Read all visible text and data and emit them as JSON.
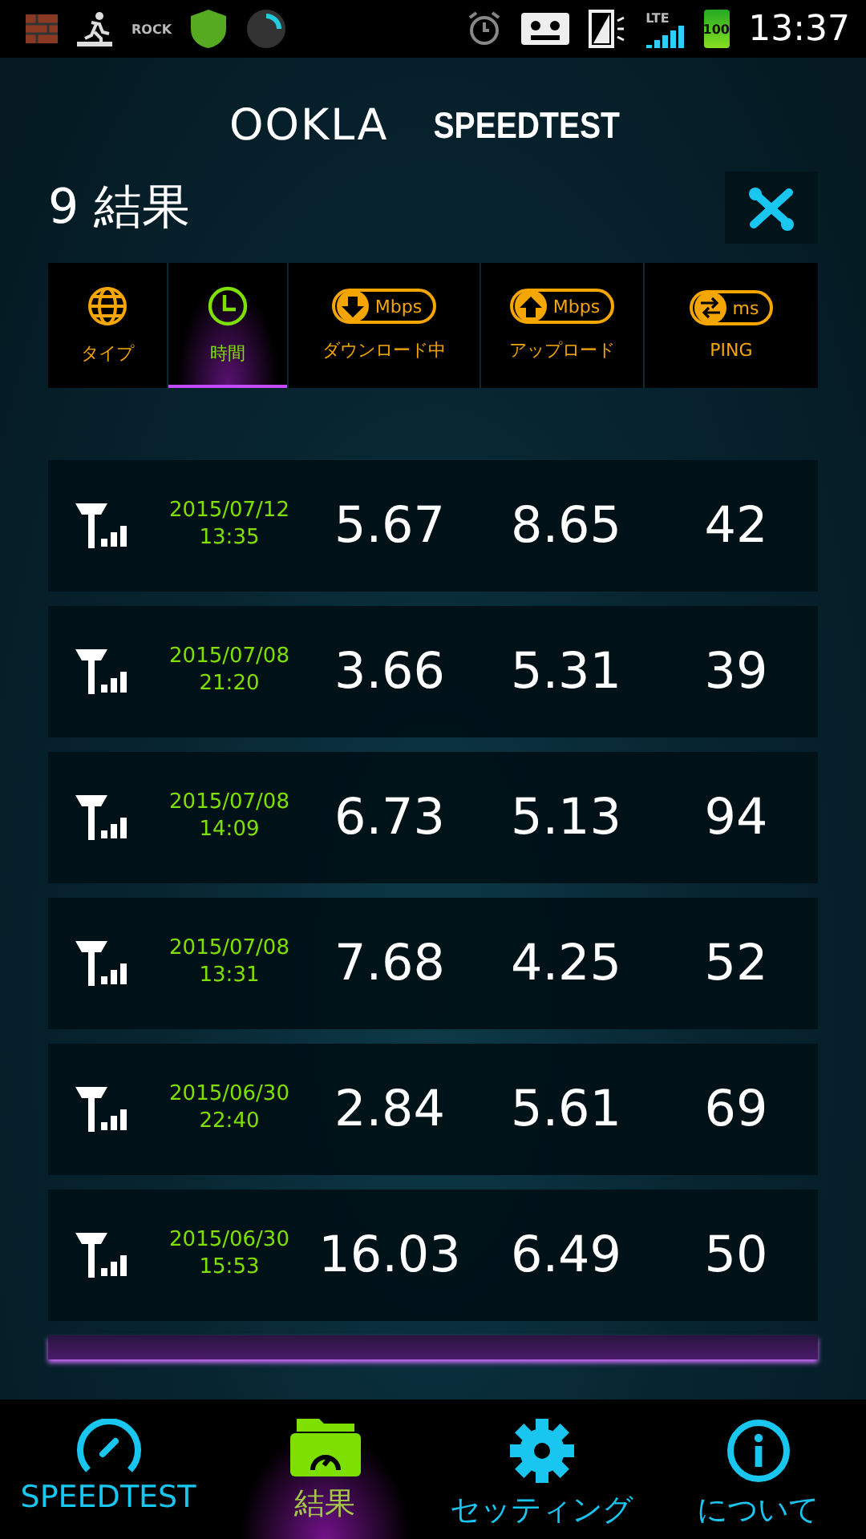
{
  "status_bar": {
    "app_label": "ROCK",
    "network_label": "LTE",
    "battery_label": "100",
    "time": "13:37"
  },
  "header": {
    "brand": "OOKLA",
    "product": "SPEEDTEST",
    "title": "9 結果"
  },
  "sort_columns": [
    {
      "kind": "type",
      "label": "タイプ",
      "selected": false
    },
    {
      "kind": "time",
      "label": "時間",
      "selected": true
    },
    {
      "kind": "download",
      "unit": "Mbps",
      "label": "ダウンロード中",
      "selected": false
    },
    {
      "kind": "upload",
      "unit": "Mbps",
      "label": "アップロード",
      "selected": false
    },
    {
      "kind": "ping",
      "unit": "ms",
      "label": "PING",
      "selected": false
    }
  ],
  "results": [
    {
      "date": "2015/07/12",
      "time": "13:35",
      "download": "5.67",
      "upload": "8.65",
      "ping": "42"
    },
    {
      "date": "2015/07/08",
      "time": "21:20",
      "download": "3.66",
      "upload": "5.31",
      "ping": "39"
    },
    {
      "date": "2015/07/08",
      "time": "14:09",
      "download": "6.73",
      "upload": "5.13",
      "ping": "94"
    },
    {
      "date": "2015/07/08",
      "time": "13:31",
      "download": "7.68",
      "upload": "4.25",
      "ping": "52"
    },
    {
      "date": "2015/06/30",
      "time": "22:40",
      "download": "2.84",
      "upload": "5.61",
      "ping": "69"
    },
    {
      "date": "2015/06/30",
      "time": "15:53",
      "download": "16.03",
      "upload": "6.49",
      "ping": "50"
    }
  ],
  "nav": [
    {
      "kind": "speedtest",
      "label": "SPEEDTEST",
      "selected": false
    },
    {
      "kind": "results",
      "label": "結果",
      "selected": true
    },
    {
      "kind": "settings",
      "label": "セッティング",
      "selected": false
    },
    {
      "kind": "about",
      "label": "について",
      "selected": false
    }
  ]
}
